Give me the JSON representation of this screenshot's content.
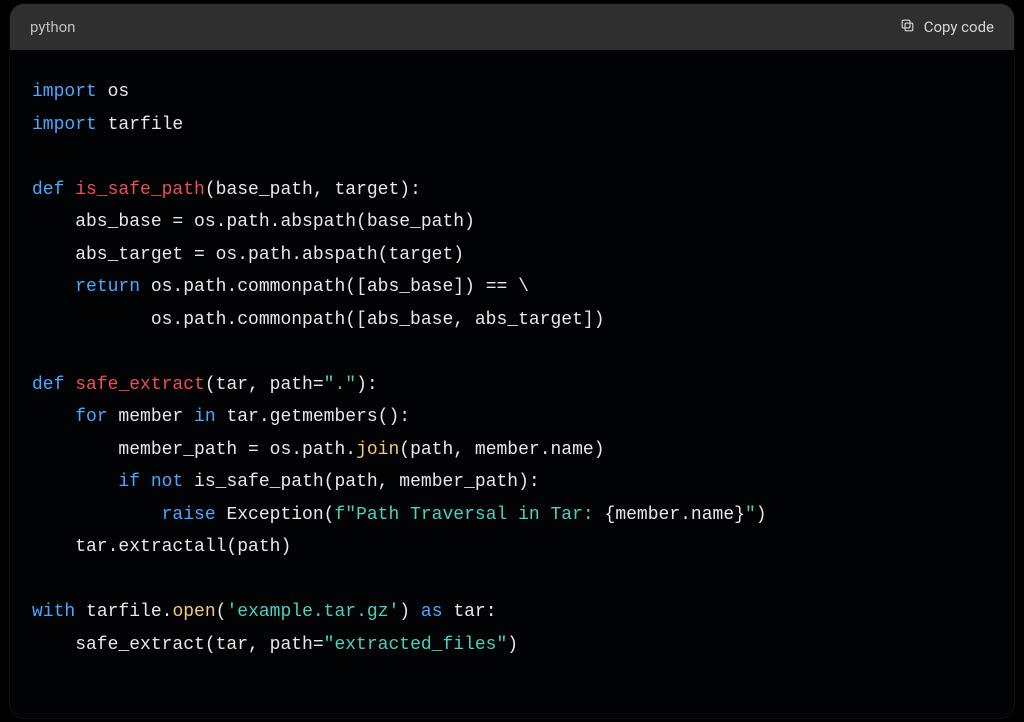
{
  "header": {
    "language": "python",
    "copy_label": "Copy code"
  },
  "code": {
    "l1_import": "import",
    "l1_os": " os",
    "l2_import": "import",
    "l2_tarfile": " tarfile",
    "blank1": "",
    "l4_def": "def ",
    "l4_name": "is_safe_path",
    "l4_sig": "(base_path, target):",
    "l5": "    abs_base = os.path.abspath(base_path)",
    "l6": "    abs_target = os.path.abspath(target)",
    "l7_pre": "    ",
    "l7_return": "return",
    "l7_post": " os.path.commonpath([abs_base]) == \\",
    "l8": "           os.path.commonpath([abs_base, abs_target])",
    "blank2": "",
    "l10_def": "def ",
    "l10_name": "safe_extract",
    "l10_sig_a": "(tar, path=",
    "l10_str": "\".\"",
    "l10_sig_b": "):",
    "l11_pre": "    ",
    "l11_for": "for",
    "l11_mid": " member ",
    "l11_in": "in",
    "l11_post": " tar.getmembers():",
    "l12_pre": "        member_path = os.path.",
    "l12_join": "join",
    "l12_post": "(path, member.name)",
    "l13_pre": "        ",
    "l13_if": "if",
    "l13_sp": " ",
    "l13_not": "not",
    "l13_post": " is_safe_path(path, member_path):",
    "l14_pre": "            ",
    "l14_raise": "raise",
    "l14_mid": " Exception(",
    "l14_f": "f\"Path Traversal in Tar: ",
    "l14_brace": "{member.name}",
    "l14_q": "\"",
    "l14_close": ")",
    "l15": "    tar.extractall(path)",
    "blank3": "",
    "l17_with": "with",
    "l17_a": " tarfile.",
    "l17_open": "open",
    "l17_b": "(",
    "l17_str": "'example.tar.gz'",
    "l17_c": ") ",
    "l17_as": "as",
    "l17_d": " tar:",
    "l18_a": "    safe_extract(tar, path=",
    "l18_str": "\"extracted_files\"",
    "l18_b": ")"
  }
}
